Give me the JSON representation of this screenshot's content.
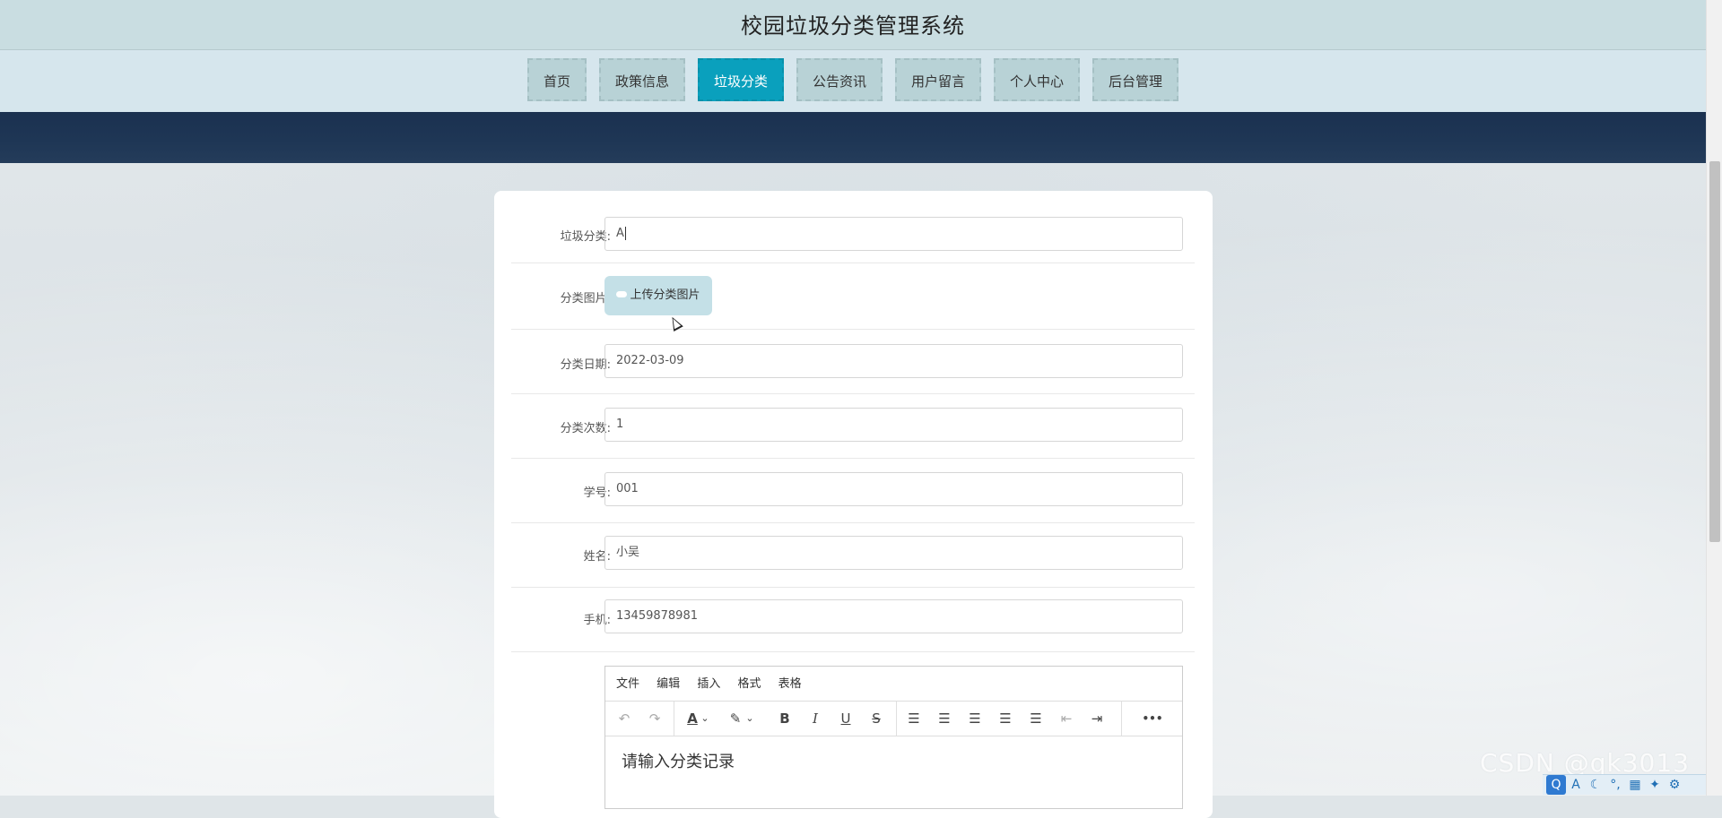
{
  "header": {
    "title": "校园垃圾分类管理系统"
  },
  "nav": {
    "items": [
      {
        "label": "首页",
        "active": false
      },
      {
        "label": "政策信息",
        "active": false
      },
      {
        "label": "垃圾分类",
        "active": true
      },
      {
        "label": "公告资讯",
        "active": false
      },
      {
        "label": "用户留言",
        "active": false
      },
      {
        "label": "个人中心",
        "active": false
      },
      {
        "label": "后台管理",
        "active": false
      }
    ]
  },
  "form": {
    "category": {
      "label": "垃圾分类:",
      "value": "A"
    },
    "image": {
      "label": "分类图片:",
      "button": "上传分类图片"
    },
    "date": {
      "label": "分类日期:",
      "value": "2022-03-09"
    },
    "count": {
      "label": "分类次数:",
      "value": "1"
    },
    "student_id": {
      "label": "学号:",
      "value": "001"
    },
    "name": {
      "label": "姓名:",
      "value": "小吴"
    },
    "phone": {
      "label": "手机:",
      "value": "13459878981"
    }
  },
  "editor": {
    "menus": [
      "文件",
      "编辑",
      "插入",
      "格式",
      "表格"
    ],
    "tools": {
      "undo": "↶",
      "redo": "↷",
      "text_color": "A",
      "text_color_arrow": "⌄",
      "highlight": "✎",
      "highlight_arrow": "⌄",
      "bold": "B",
      "italic": "I",
      "underline": "U",
      "strike": "S",
      "list": "☰",
      "align_left": "☰",
      "align_center": "☰",
      "align_right": "☰",
      "justify": "☰",
      "outdent": "⇤",
      "indent": "⇥",
      "more": "•••"
    },
    "placeholder": "请输入分类记录"
  },
  "watermark": "CSDN @qk3013",
  "tray": {
    "icons": [
      "Q",
      "A",
      "☾",
      "°,",
      "▦",
      "✦",
      "⚙"
    ]
  },
  "colors": {
    "active_nav": "#0aa0bd",
    "nav_bg": "#b8d2d6",
    "banner": "#1e3655",
    "upload_btn": "#c4e0e7"
  }
}
